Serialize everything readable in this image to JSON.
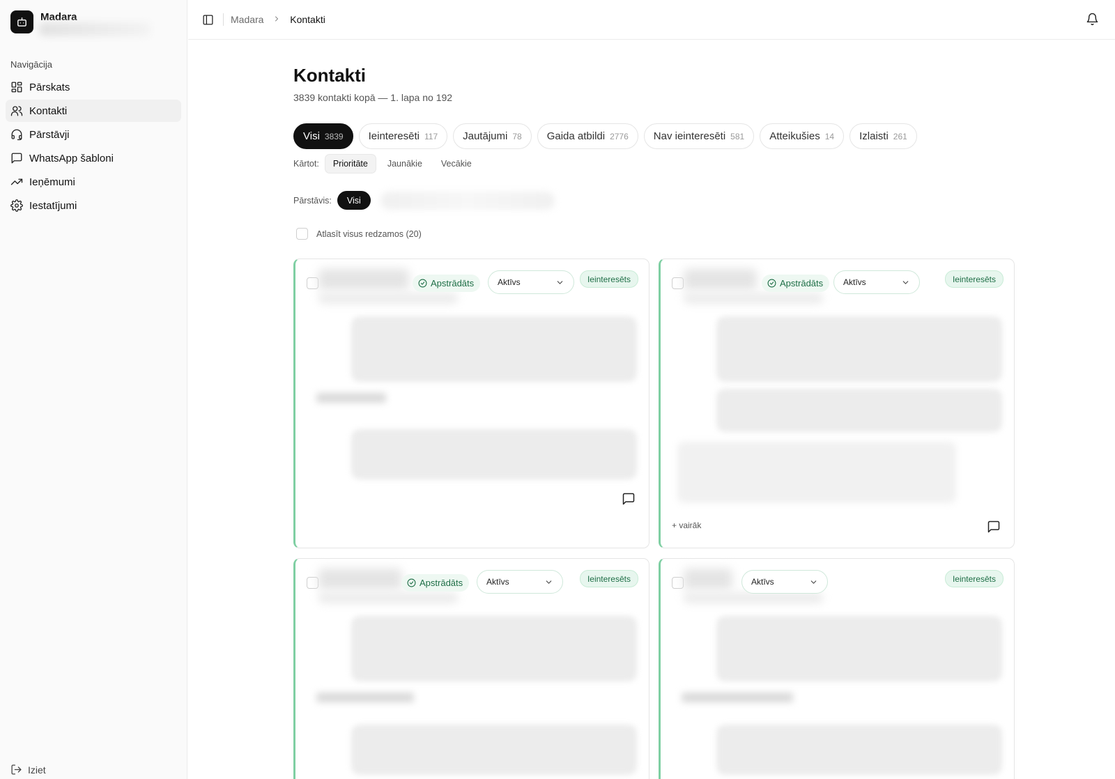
{
  "brand": {
    "name": "Madara"
  },
  "sidebar": {
    "section_title": "Navigācija",
    "items": [
      {
        "label": "Pārskats",
        "icon": "dashboard-icon"
      },
      {
        "label": "Kontakti",
        "icon": "users-icon"
      },
      {
        "label": "Pārstāvji",
        "icon": "headset-icon"
      },
      {
        "label": "WhatsApp šabloni",
        "icon": "message-square-icon"
      },
      {
        "label": "Ieņēmumi",
        "icon": "trending-up-icon"
      },
      {
        "label": "Iestatījumi",
        "icon": "gear-icon"
      }
    ],
    "active_item": "Kontakti",
    "logout_label": "Iziet"
  },
  "topbar": {
    "breadcrumb": [
      "Madara",
      "Kontakti"
    ]
  },
  "page": {
    "title": "Kontakti",
    "subtitle": "3839 kontakti kopā — 1. lapa no 192"
  },
  "tabs": [
    {
      "label": "Visi",
      "count": "3839"
    },
    {
      "label": "Ieinteresēti",
      "count": "117"
    },
    {
      "label": "Jautājumi",
      "count": "78"
    },
    {
      "label": "Gaida atbildi",
      "count": "2776"
    },
    {
      "label": "Nav ieinteresēti",
      "count": "581"
    },
    {
      "label": "Atteikušies",
      "count": "14"
    },
    {
      "label": "Izlaisti",
      "count": "261"
    }
  ],
  "active_tab": "Visi",
  "sort": {
    "label": "Kārtot:",
    "options": [
      "Prioritāte",
      "Jaunākie",
      "Vecākie"
    ],
    "active": "Prioritāte"
  },
  "representative": {
    "label": "Pārstāvis:",
    "selected": "Visi"
  },
  "select_all_label": "Atlasīt visus redzamos (20)",
  "cards": [
    {
      "processed": "Apstrādāts",
      "status": "Aktīvs",
      "badge": "Ieinteresēts",
      "more": ""
    },
    {
      "processed": "Apstrādāts",
      "status": "Aktīvs",
      "badge": "Ieinteresēts",
      "more": "+ vairāk"
    },
    {
      "processed": "Apstrādāts",
      "status": "Aktīvs",
      "badge": "Ieinteresēts",
      "more": ""
    },
    {
      "processed": "",
      "status": "Aktīvs",
      "badge": "Ieinteresēts",
      "more": ""
    }
  ],
  "colors": {
    "accent": "#7fcfa3",
    "badge_text": "#1e6e46",
    "primary": "#111111"
  }
}
